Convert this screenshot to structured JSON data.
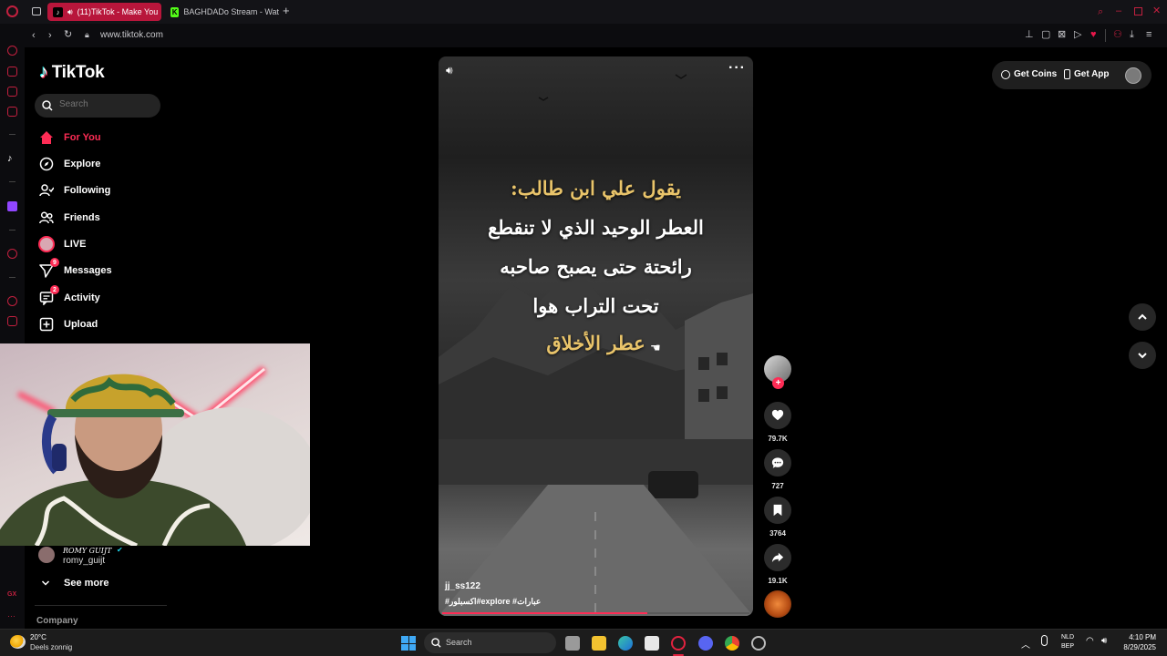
{
  "browser": {
    "tabs": [
      {
        "title": "(11)TikTok - Make You",
        "icon": "tiktok-icon",
        "active": true
      },
      {
        "title": "BAGHDADo Stream - Wat",
        "icon": "kick-icon",
        "active": false
      }
    ],
    "url": "www.tiktok.com"
  },
  "sidebar": {
    "logo_text": "TikTok",
    "search_placeholder": "Search",
    "nav": [
      {
        "label": "For You",
        "icon": "home-icon",
        "active": true
      },
      {
        "label": "Explore",
        "icon": "compass-icon"
      },
      {
        "label": "Following",
        "icon": "following-icon"
      },
      {
        "label": "Friends",
        "icon": "friends-icon"
      },
      {
        "label": "LIVE",
        "icon": "live-icon"
      },
      {
        "label": "Messages",
        "icon": "messages-icon",
        "badge": "9"
      },
      {
        "label": "Activity",
        "icon": "activity-icon",
        "badge": "2"
      },
      {
        "label": "Upload",
        "icon": "upload-icon"
      }
    ],
    "following_account": {
      "display_name": "ROMY GUIJT",
      "username": "romy_guijt"
    },
    "see_more": "See more",
    "company": "Company"
  },
  "header": {
    "get_coins": "Get Coins",
    "get_app": "Get App"
  },
  "video": {
    "quote_lines": [
      "يقول علي ابن طالب:",
      "العطر الوحيد الذي لا تنقطع",
      "رائحتة حتى يصبح صاحبه",
      "تحت التراب هوا",
      "عطر الأخلاق"
    ],
    "author": "jj_ss122",
    "hashtags": "#اكسبلور#explore #عبارات"
  },
  "actions": {
    "likes": "79.7K",
    "comments": "727",
    "saves": "3764",
    "shares": "19.1K"
  },
  "taskbar": {
    "weather_temp": "20°C",
    "weather_desc": "Deels zonnig",
    "search_label": "Search",
    "lang_top": "NLD",
    "lang_bottom": "BEP",
    "time": "4:10 PM",
    "date": "8/29/2025"
  },
  "colors": {
    "accent": "#fe2c55",
    "tab_active": "#b8163b",
    "quote_gold": "#e9c46a",
    "quote_white": "#ffffff"
  }
}
